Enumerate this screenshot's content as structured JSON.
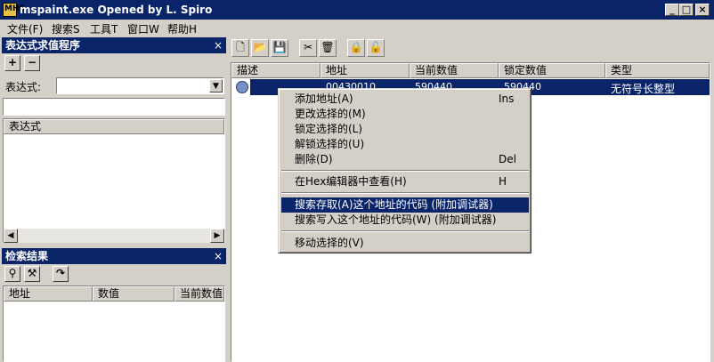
{
  "window": {
    "title": "mspaint.exe Opened by L. Spiro",
    "icon_label": "MHS",
    "minimize": "_",
    "maximize": "□",
    "close": "×"
  },
  "menu": [
    "文件(F)",
    "搜索S",
    "工具T",
    "窗口W",
    "帮助H"
  ],
  "expr_panel": {
    "title": "表达式求值程序",
    "close": "×",
    "add_btn": "+",
    "remove_btn": "−",
    "label": "表达式:",
    "combo_value": "",
    "input_value": "",
    "list_header": "表达式"
  },
  "search_panel": {
    "title": "检索结果",
    "close": "×",
    "columns": [
      "地址",
      "数值",
      "当前数值"
    ]
  },
  "main_table": {
    "columns": [
      "描述",
      "地址",
      "当前数值",
      "锁定数值",
      "类型"
    ],
    "rows": [
      {
        "desc": "",
        "address": "00430010",
        "current": "590440",
        "locked": "590440",
        "type": "无符号长整型"
      }
    ]
  },
  "context_menu": {
    "items": [
      {
        "label": "添加地址(A)",
        "shortcut": "Ins"
      },
      {
        "label": "更改选择的(M)",
        "shortcut": ""
      },
      {
        "label": "锁定选择的(L)",
        "shortcut": ""
      },
      {
        "label": "解锁选择的(U)",
        "shortcut": ""
      },
      {
        "label": "删除(D)",
        "shortcut": "Del"
      },
      {
        "label": "在Hex编辑器中查看(H)",
        "shortcut": "H"
      },
      {
        "label": "搜索存取(A)这个地址的代码 (附加调试器)",
        "shortcut": ""
      },
      {
        "label": "搜索写入这个地址的代码(W) (附加调试器)",
        "shortcut": ""
      },
      {
        "label": "移动选择的(V)",
        "shortcut": ""
      }
    ],
    "highlighted_index": 6
  },
  "icons": {
    "toolbar": [
      "new-icon",
      "open-icon",
      "save-icon",
      "cut-icon",
      "delete-icon",
      "lock-icon",
      "unlock-icon"
    ],
    "search_toolbar": [
      "search-icon",
      "search-more-icon",
      "jump-icon"
    ]
  },
  "colors": {
    "titlebar": "#0a246a",
    "highlight": "#0a246a",
    "face": "#d4d0c8"
  }
}
